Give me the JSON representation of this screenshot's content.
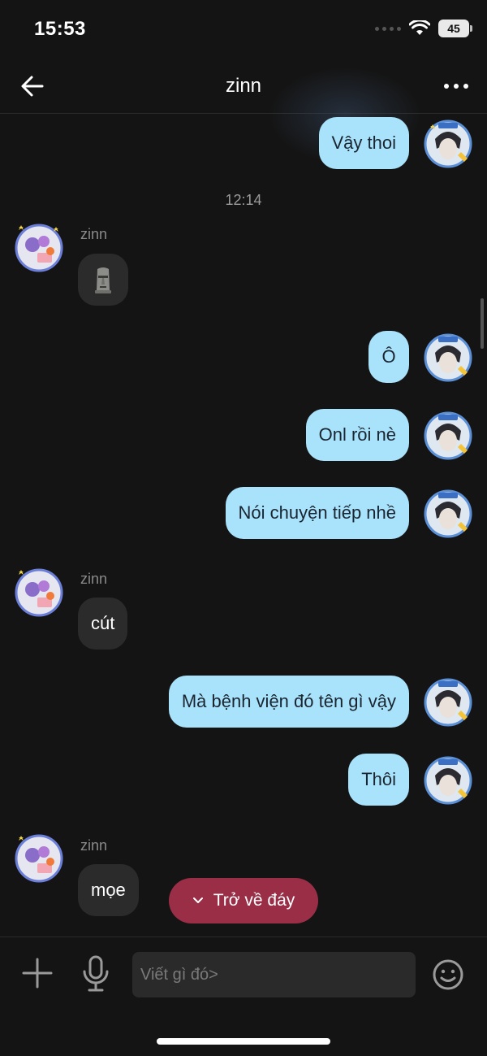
{
  "status_bar": {
    "time": "15:53",
    "battery": "45"
  },
  "header": {
    "title": "zinn",
    "back_icon": "arrow-left-icon",
    "more_icon": "more-horizontal-icon"
  },
  "messages": [
    {
      "from": "me",
      "text": "Vậy thoi"
    },
    {
      "type": "timestamp",
      "text": "12:14"
    },
    {
      "from": "them",
      "sender": "zinn",
      "text": "",
      "sticker": "moai-emoji"
    },
    {
      "from": "me",
      "text": "Ô"
    },
    {
      "from": "me",
      "text": "Onl rồi nè"
    },
    {
      "from": "me",
      "text": "Nói chuyện tiếp nhề"
    },
    {
      "from": "them",
      "sender": "zinn",
      "text": "cút"
    },
    {
      "from": "me",
      "text": "Mà bệnh viện đó tên gì vậy"
    },
    {
      "from": "me",
      "text": "Thôi"
    },
    {
      "from": "them",
      "sender": "zinn",
      "text": "mọe"
    }
  ],
  "scroll_to_bottom": {
    "label": "Trở về đáy",
    "icon": "chevron-down-icon"
  },
  "input_bar": {
    "placeholder": "Viết gì đó>",
    "value": ""
  },
  "colors": {
    "background": "#141414",
    "my_bubble": "#a9e2fb",
    "their_bubble": "#2b2b2b",
    "accent_button": "#9a2e47"
  }
}
